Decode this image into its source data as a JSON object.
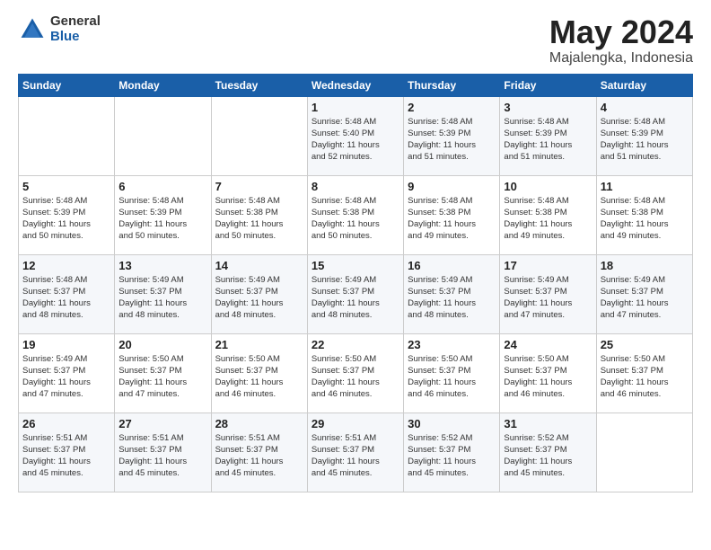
{
  "header": {
    "logo_general": "General",
    "logo_blue": "Blue",
    "title": "May 2024",
    "subtitle": "Majalengka, Indonesia"
  },
  "days_of_week": [
    "Sunday",
    "Monday",
    "Tuesday",
    "Wednesday",
    "Thursday",
    "Friday",
    "Saturday"
  ],
  "weeks": [
    [
      {
        "day": "",
        "info": ""
      },
      {
        "day": "",
        "info": ""
      },
      {
        "day": "",
        "info": ""
      },
      {
        "day": "1",
        "info": "Sunrise: 5:48 AM\nSunset: 5:40 PM\nDaylight: 11 hours\nand 52 minutes."
      },
      {
        "day": "2",
        "info": "Sunrise: 5:48 AM\nSunset: 5:39 PM\nDaylight: 11 hours\nand 51 minutes."
      },
      {
        "day": "3",
        "info": "Sunrise: 5:48 AM\nSunset: 5:39 PM\nDaylight: 11 hours\nand 51 minutes."
      },
      {
        "day": "4",
        "info": "Sunrise: 5:48 AM\nSunset: 5:39 PM\nDaylight: 11 hours\nand 51 minutes."
      }
    ],
    [
      {
        "day": "5",
        "info": "Sunrise: 5:48 AM\nSunset: 5:39 PM\nDaylight: 11 hours\nand 50 minutes."
      },
      {
        "day": "6",
        "info": "Sunrise: 5:48 AM\nSunset: 5:39 PM\nDaylight: 11 hours\nand 50 minutes."
      },
      {
        "day": "7",
        "info": "Sunrise: 5:48 AM\nSunset: 5:38 PM\nDaylight: 11 hours\nand 50 minutes."
      },
      {
        "day": "8",
        "info": "Sunrise: 5:48 AM\nSunset: 5:38 PM\nDaylight: 11 hours\nand 50 minutes."
      },
      {
        "day": "9",
        "info": "Sunrise: 5:48 AM\nSunset: 5:38 PM\nDaylight: 11 hours\nand 49 minutes."
      },
      {
        "day": "10",
        "info": "Sunrise: 5:48 AM\nSunset: 5:38 PM\nDaylight: 11 hours\nand 49 minutes."
      },
      {
        "day": "11",
        "info": "Sunrise: 5:48 AM\nSunset: 5:38 PM\nDaylight: 11 hours\nand 49 minutes."
      }
    ],
    [
      {
        "day": "12",
        "info": "Sunrise: 5:48 AM\nSunset: 5:37 PM\nDaylight: 11 hours\nand 48 minutes."
      },
      {
        "day": "13",
        "info": "Sunrise: 5:49 AM\nSunset: 5:37 PM\nDaylight: 11 hours\nand 48 minutes."
      },
      {
        "day": "14",
        "info": "Sunrise: 5:49 AM\nSunset: 5:37 PM\nDaylight: 11 hours\nand 48 minutes."
      },
      {
        "day": "15",
        "info": "Sunrise: 5:49 AM\nSunset: 5:37 PM\nDaylight: 11 hours\nand 48 minutes."
      },
      {
        "day": "16",
        "info": "Sunrise: 5:49 AM\nSunset: 5:37 PM\nDaylight: 11 hours\nand 48 minutes."
      },
      {
        "day": "17",
        "info": "Sunrise: 5:49 AM\nSunset: 5:37 PM\nDaylight: 11 hours\nand 47 minutes."
      },
      {
        "day": "18",
        "info": "Sunrise: 5:49 AM\nSunset: 5:37 PM\nDaylight: 11 hours\nand 47 minutes."
      }
    ],
    [
      {
        "day": "19",
        "info": "Sunrise: 5:49 AM\nSunset: 5:37 PM\nDaylight: 11 hours\nand 47 minutes."
      },
      {
        "day": "20",
        "info": "Sunrise: 5:50 AM\nSunset: 5:37 PM\nDaylight: 11 hours\nand 47 minutes."
      },
      {
        "day": "21",
        "info": "Sunrise: 5:50 AM\nSunset: 5:37 PM\nDaylight: 11 hours\nand 46 minutes."
      },
      {
        "day": "22",
        "info": "Sunrise: 5:50 AM\nSunset: 5:37 PM\nDaylight: 11 hours\nand 46 minutes."
      },
      {
        "day": "23",
        "info": "Sunrise: 5:50 AM\nSunset: 5:37 PM\nDaylight: 11 hours\nand 46 minutes."
      },
      {
        "day": "24",
        "info": "Sunrise: 5:50 AM\nSunset: 5:37 PM\nDaylight: 11 hours\nand 46 minutes."
      },
      {
        "day": "25",
        "info": "Sunrise: 5:50 AM\nSunset: 5:37 PM\nDaylight: 11 hours\nand 46 minutes."
      }
    ],
    [
      {
        "day": "26",
        "info": "Sunrise: 5:51 AM\nSunset: 5:37 PM\nDaylight: 11 hours\nand 45 minutes."
      },
      {
        "day": "27",
        "info": "Sunrise: 5:51 AM\nSunset: 5:37 PM\nDaylight: 11 hours\nand 45 minutes."
      },
      {
        "day": "28",
        "info": "Sunrise: 5:51 AM\nSunset: 5:37 PM\nDaylight: 11 hours\nand 45 minutes."
      },
      {
        "day": "29",
        "info": "Sunrise: 5:51 AM\nSunset: 5:37 PM\nDaylight: 11 hours\nand 45 minutes."
      },
      {
        "day": "30",
        "info": "Sunrise: 5:52 AM\nSunset: 5:37 PM\nDaylight: 11 hours\nand 45 minutes."
      },
      {
        "day": "31",
        "info": "Sunrise: 5:52 AM\nSunset: 5:37 PM\nDaylight: 11 hours\nand 45 minutes."
      },
      {
        "day": "",
        "info": ""
      }
    ]
  ]
}
